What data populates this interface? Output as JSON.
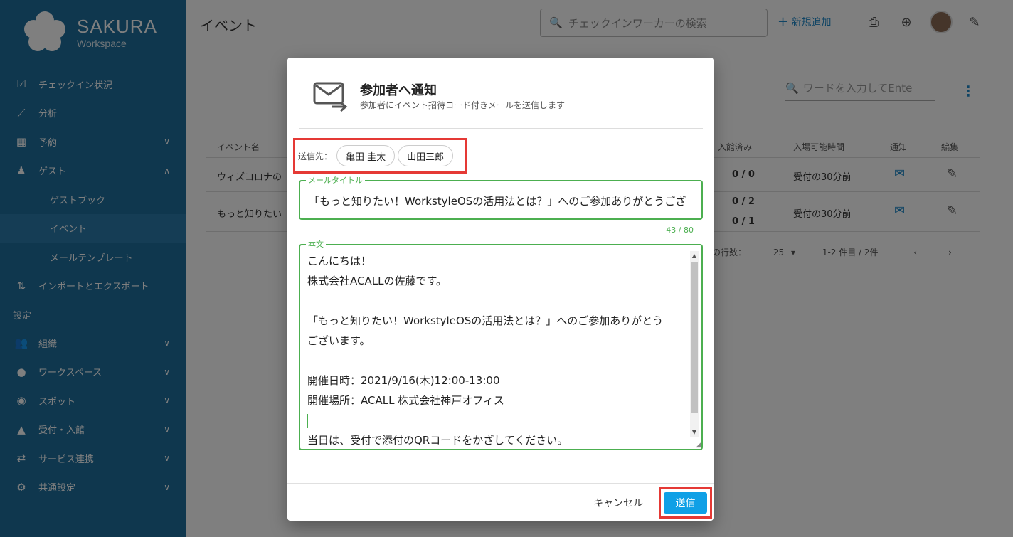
{
  "brand": {
    "title": "SAKURA",
    "subtitle": "Workspace"
  },
  "sidebar": {
    "items": [
      {
        "label": "チェックイン状況",
        "icon": "checkbox-icon"
      },
      {
        "label": "分析",
        "icon": "chart-line-icon"
      },
      {
        "label": "予約",
        "icon": "calendar-clock-icon",
        "expand": "down"
      },
      {
        "label": "ゲスト",
        "icon": "guest-icon",
        "expand": "up"
      },
      {
        "label": "ゲストブック",
        "sub": true
      },
      {
        "label": "イベント",
        "sub": true,
        "active": true
      },
      {
        "label": "メールテンプレート",
        "sub": true
      },
      {
        "label": "インポートとエクスポート",
        "icon": "import-export-icon"
      }
    ],
    "section_label": "設定",
    "settings": [
      {
        "label": "組織",
        "icon": "people-icon"
      },
      {
        "label": "ワークスペース",
        "icon": "location-pin-icon"
      },
      {
        "label": "スポット",
        "icon": "spot-pin-icon"
      },
      {
        "label": "受付・入館",
        "icon": "reception-bell-icon"
      },
      {
        "label": "サービス連携",
        "icon": "integration-icon"
      },
      {
        "label": "共通設定",
        "icon": "settings-gears-icon"
      }
    ]
  },
  "header": {
    "page_title": "イベント",
    "search_placeholder": "チェックインワーカーの検索",
    "add_label": "新規追加"
  },
  "table": {
    "search_placeholder": "ワードを入力してEnte",
    "columns": {
      "name": "イベント名",
      "checked_in": "入館済み",
      "entry_time": "入場可能時間",
      "notify": "通知",
      "edit": "編集"
    },
    "rows": [
      {
        "name": "ウィズコロナの",
        "checked_in": "0 / 0",
        "entry_time": "受付の30分前"
      },
      {
        "name": "もっと知りたい",
        "checked_in_a": "0 / 2",
        "checked_in_b": "0 / 1",
        "entry_time": "受付の30分前"
      }
    ],
    "rows_per_page_label": "の行数：",
    "rows_per_page": "25",
    "range": "1-2 件目 / 2件"
  },
  "dialog": {
    "title": "参加者へ通知",
    "subtitle": "参加者にイベント招待コード付きメールを送信します",
    "recipients_label": "送信先：",
    "recipients": [
      "亀田 圭太",
      "山田三郎"
    ],
    "mail_title_label": "メールタイトル",
    "mail_title_value": "「もっと知りたい！WorkstyleOSの活用法とは？」へのご参加ありがとうござ",
    "mail_title_counter": "43 / 80",
    "body_label": "本文",
    "body_lines": [
      "こんにちは！",
      "株式会社ACALLの佐藤です。",
      "",
      "「もっと知りたい！WorkstyleOSの活用法とは？」へのご参加ありがとう",
      "ございます。",
      "",
      "開催日時：2021/9/16(木)12:00-13:00",
      "開催場所：ACALL 株式会社神戸オフィス",
      "",
      "当日は、受付で添付のQRコードをかざしてください。"
    ],
    "cancel_label": "キャンセル",
    "send_label": "送信"
  },
  "colors": {
    "sidebar": "#1f6e9c",
    "accent": "#0fa0e6",
    "success": "#4caf50",
    "highlight": "#e53935"
  }
}
